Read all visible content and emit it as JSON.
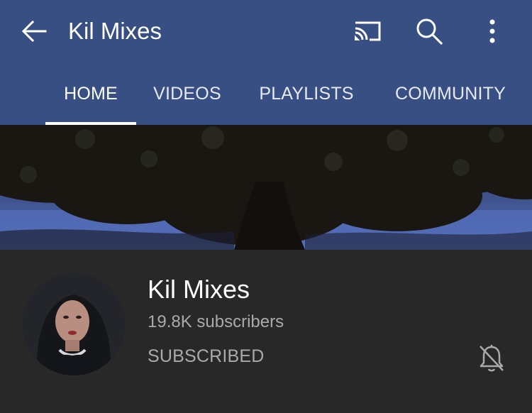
{
  "app_bar": {
    "title": "Kil Mixes",
    "icons": [
      "back-arrow-icon",
      "cast-icon",
      "search-icon",
      "more-vert-icon"
    ]
  },
  "tabs": [
    {
      "label": "HOME",
      "active": true
    },
    {
      "label": "VIDEOS",
      "active": false
    },
    {
      "label": "PLAYLISTS",
      "active": false
    },
    {
      "label": "COMMUNITY",
      "active": false
    }
  ],
  "channel": {
    "name": "Kil Mixes",
    "subscribers": "19.8K subscribers",
    "subscribe_state": "SUBSCRIBED",
    "notification_icon": "bell-off-icon"
  },
  "colors": {
    "app_bar": "#384f84",
    "background": "#282828",
    "primary_text": "#ffffff",
    "secondary_text": "#aaaaaa"
  }
}
